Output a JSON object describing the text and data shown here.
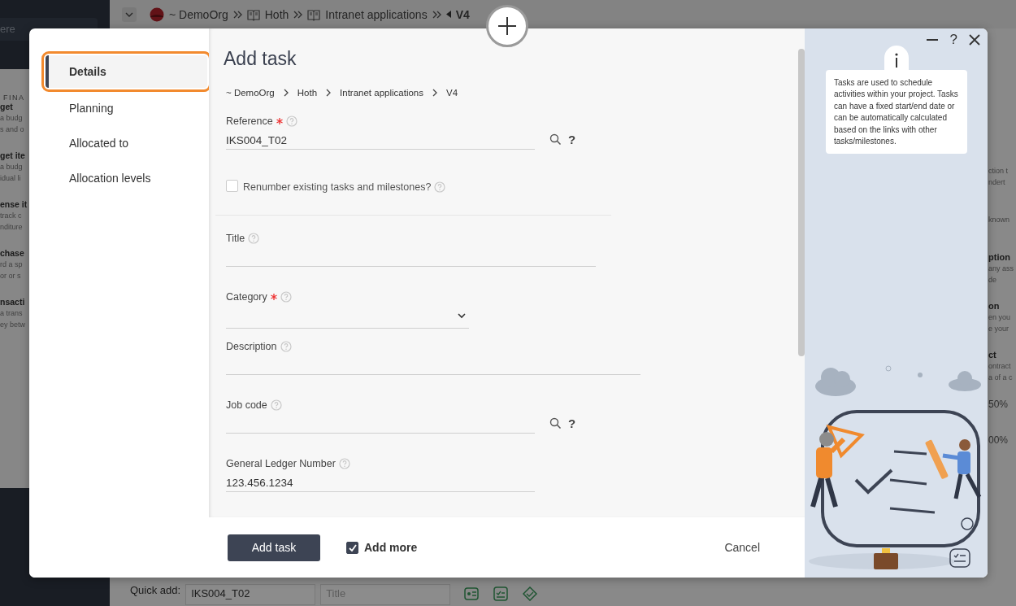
{
  "background": {
    "sidebar_search": {
      "placeholder": "ere"
    },
    "topbar": {
      "crumbs": [
        {
          "kind": "org",
          "label": "~ DemoOrg"
        },
        {
          "kind": "book",
          "label": "Hoth"
        },
        {
          "kind": "book",
          "label": "Intranet applications"
        },
        {
          "kind": "version",
          "label": "V4"
        }
      ]
    },
    "left_menu": {
      "heading": "FINA",
      "items": [
        {
          "title": "get",
          "lines": [
            "a budg",
            "s and o"
          ]
        },
        {
          "title": "get ite",
          "lines": [
            "a budg",
            "idual li"
          ]
        },
        {
          "title": "ense it",
          "lines": [
            "track c",
            "nditure"
          ]
        },
        {
          "title": "chase",
          "lines": [
            "rd a sp",
            "or or s"
          ]
        },
        {
          "title": "nsacti",
          "lines": [
            "a trans",
            "ey betw"
          ]
        }
      ]
    },
    "right_menu": {
      "items": [
        {
          "lines": [
            "ction t",
            "ndert"
          ]
        },
        {
          "lines": [
            "known"
          ]
        },
        {
          "title": "ption",
          "lines": [
            "any ass",
            "de"
          ]
        },
        {
          "title": "on",
          "lines": [
            "en you",
            "e your"
          ]
        },
        {
          "title": "ct",
          "lines": [
            "ontract",
            "a of a c"
          ]
        }
      ]
    },
    "progress_cells": [
      "50%",
      "00%"
    ],
    "quick_add": {
      "label": "Quick add:",
      "reference": "IKS004_T02",
      "title_placeholder": "Title"
    }
  },
  "dialog": {
    "nav": [
      {
        "label": "Details",
        "selected": true,
        "highlighted": true
      },
      {
        "label": "Planning",
        "selected": false,
        "highlighted": false
      },
      {
        "label": "Allocated to",
        "selected": false,
        "highlighted": false
      },
      {
        "label": "Allocation levels",
        "selected": false,
        "highlighted": false
      }
    ],
    "title": "Add task",
    "breadcrumb": [
      "~ DemoOrg",
      "Hoth",
      "Intranet applications",
      "V4"
    ],
    "fields": [
      {
        "kind": "lookup",
        "label": "Reference",
        "required": true,
        "value": "IKS004_T02",
        "help_mark": "?"
      },
      {
        "kind": "checkbox",
        "label": "Renumber existing tasks and milestones?",
        "checked": false
      },
      {
        "kind": "text",
        "label": "Title",
        "required": false
      },
      {
        "kind": "select",
        "label": "Category",
        "required": true
      },
      {
        "kind": "text",
        "label": "Description",
        "required": false
      },
      {
        "kind": "lookup",
        "label": "Job code",
        "required": false,
        "help_mark": "?"
      },
      {
        "kind": "text",
        "label": "General Ledger Number",
        "required": false,
        "value": "123.456.1234"
      }
    ],
    "footer": {
      "submit": "Add task",
      "add_more": {
        "label": "Add more",
        "checked": true
      },
      "cancel": "Cancel"
    },
    "window_controls": {
      "help": "?"
    },
    "info": "Tasks are used to schedule activities within your project. Tasks can have a fixed start/end date or can be automatically calculated based on the links with other tasks/milestones."
  }
}
